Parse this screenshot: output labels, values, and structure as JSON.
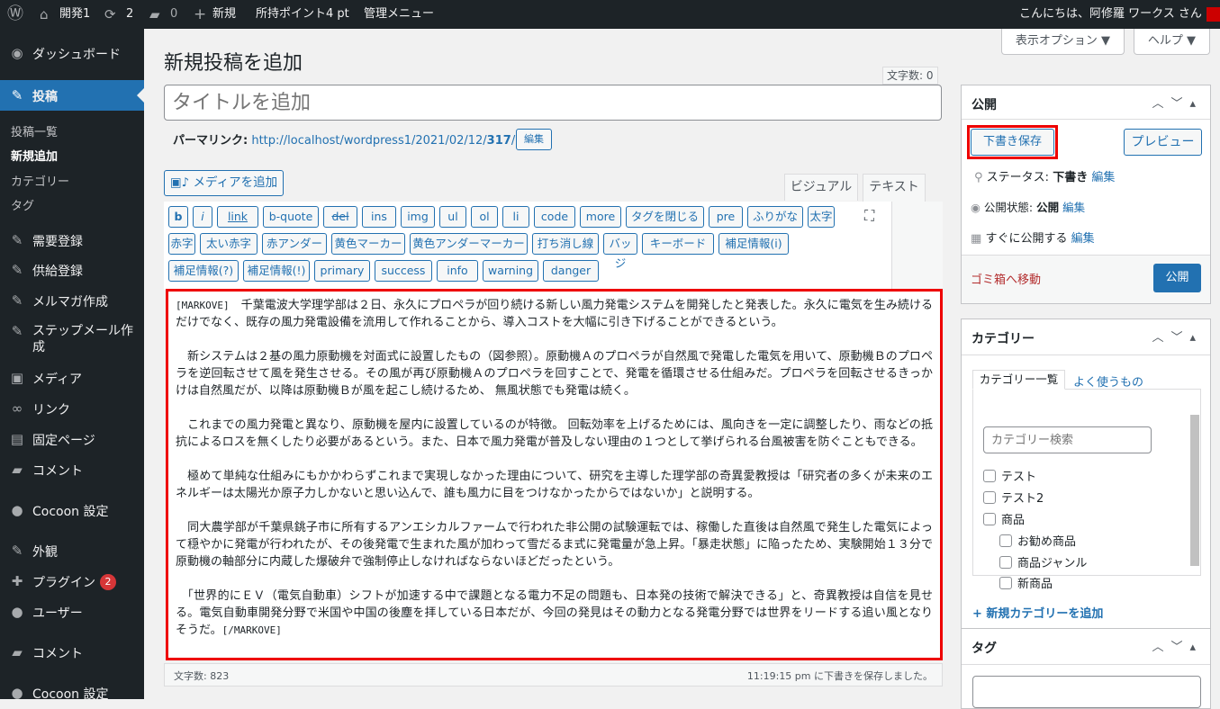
{
  "adminbar": {
    "site": "開発1",
    "updates": "2",
    "comments": "0",
    "new": "新規",
    "points": "所持ポイント4 pt",
    "admin_menu": "管理メニュー",
    "greeting": "こんにちは、阿修羅 ワークス さん"
  },
  "sidebar": {
    "dashboard": "ダッシュボード",
    "posts": "投稿",
    "sub": [
      "投稿一覧",
      "新規追加",
      "カテゴリー",
      "タグ"
    ],
    "items": [
      "需要登録",
      "供給登録",
      "メルマガ作成",
      "ステップメール作成",
      "メディア",
      "リンク",
      "固定ページ",
      "コメント",
      "Cocoon 設定",
      "外観",
      "プラグイン",
      "ユーザー",
      "コメント",
      "Cocoon 設定"
    ],
    "plugin_badge": "2"
  },
  "header": {
    "title": "新規投稿を追加",
    "screen_options": "表示オプション ▼",
    "help": "ヘルプ ▼",
    "char_count": "文字数: 0"
  },
  "title_input": {
    "placeholder": "タイトルを追加"
  },
  "permalink": {
    "label": "パーマリンク:",
    "url": "http://localhost/wordpress1/2021/02/12/",
    "slug": "317",
    "suffix": "/",
    "edit": "編集"
  },
  "media_button": "メディアを追加",
  "tabs": {
    "visual": "ビジュアル",
    "text": "テキスト"
  },
  "quicktags": {
    "row1": [
      "b",
      "i",
      "link",
      "b-quote",
      "del",
      "ins",
      "img",
      "ul",
      "ol",
      "li",
      "code",
      "more",
      "タグを閉じる",
      "pre",
      "ふりがな",
      "太字"
    ],
    "row2": [
      "赤字",
      "太い赤字",
      "赤アンダー",
      "黄色マーカー",
      "黄色アンダーマーカー",
      "打ち消し線",
      "バッジ",
      "キーボード",
      "補足情報(i)"
    ],
    "row3": [
      "補足情報(?)",
      "補足情報(!)",
      "primary",
      "success",
      "info",
      "warning",
      "danger"
    ]
  },
  "content": {
    "p1_tag": "[MARKOVE]",
    "p1": "　千葉電波大学理学部は２日、永久にプロペラが回り続ける新しい風力発電システムを開発したと発表した。永久に電気を生み続けるだけでなく、既存の風力発電設備を流用して作れることから、導入コストを大幅に引き下げることができるという。",
    "p2": "　新システムは２基の風力原動機を対面式に設置したもの（図参照）。原動機Ａのプロペラが自然風で発電した電気を用いて、原動機Ｂのプロペラを逆回転させて風を発生させる。その風が再び原動機Ａのプロペラを回すことで、発電を循環させる仕組みだ。プロペラを回転させるきっかけは自然風だが、以降は原動機Ｂが風を起こし続けるため、 無風状態でも発電は続く。",
    "p3": "　これまでの風力発電と異なり、原動機を屋内に設置しているのが特徴。 回転効率を上げるためには、風向きを一定に調整したり、雨などの抵抗によるロスを無くしたり必要があるという。また、日本で風力発電が普及しない理由の１つとして挙げられる台風被害を防ぐこともできる。",
    "p4": "　極めて単純な仕組みにもかかわらずこれまで実現しなかった理由について、研究を主導した理学部の奇異愛教授は「研究者の多くが未来のエネルギーは太陽光か原子力しかないと思い込んで、誰も風力に目をつけなかったからではないか」と説明する。",
    "p5": "　同大農学部が千葉県銚子市に所有するアンエシカルファームで行われた非公開の試験運転では、稼働した直後は自然風で発生した電気によって穏やかに発電が行われたが、その後発電で生まれた風が加わって雪だるま式に発電量が急上昇。「暴走状態」に陥ったため、実験開始１３分で原動機の軸部分に内蔵した爆破弁で強制停止しなければならないほどだったという。",
    "p6": "　「世界的にＥＶ（電気自動車）シフトが加速する中で課題となる電力不足の問題も、日本発の技術で解決できる」と、奇異教授は自信を見せる。電気自動車開発分野で米国や中国の後塵を拝している日本だが、今回の発見はその動力となる発電分野では世界をリードする追い風となりそうだ。",
    "p6_tag": "[/MARKOVE]"
  },
  "status_bar": {
    "count": "文字数: 823",
    "saved": "11:19:15 pm に下書きを保存しました。"
  },
  "publish": {
    "title": "公開",
    "save_draft": "下書き保存",
    "preview": "プレビュー",
    "status_label": "ステータス:",
    "status_value": "下書き",
    "visibility_label": "公開状態:",
    "visibility_value": "公開",
    "schedule": "すぐに公開する",
    "edit": "編集",
    "trash": "ゴミ箱へ移動",
    "publish": "公開"
  },
  "category": {
    "title": "カテゴリー",
    "tab_all": "カテゴリー一覧",
    "tab_popular": "よく使うもの",
    "search_placeholder": "カテゴリー検索",
    "items": [
      "テスト",
      "テスト2",
      "商品",
      "お勧め商品",
      "商品ジャンル",
      "新商品"
    ],
    "add": "+ 新規カテゴリーを追加"
  },
  "tags": {
    "title": "タグ"
  },
  "colors": {
    "accent": "#2271b1",
    "highlight": "#e00000",
    "adminbar": "#1d2327",
    "current_menu": "#2271b1"
  }
}
